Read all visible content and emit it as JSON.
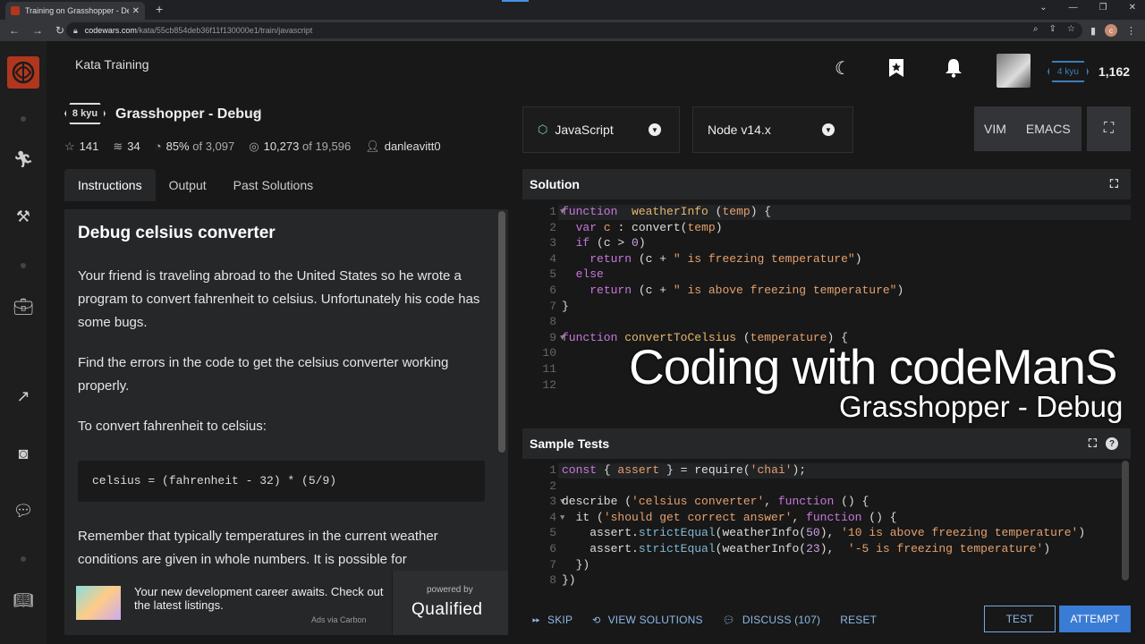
{
  "browser": {
    "tab_title": "Training on Grasshopper - Debu",
    "tab_close": "✕",
    "new_tab": "+",
    "url_host": "codewars.com",
    "url_path": "/kata/55cb854deb36f11f130000e1/train/javascript",
    "window_controls": [
      "⌄",
      "—",
      "❐",
      "✕"
    ]
  },
  "header": {
    "section_title": "Kata Training",
    "rank_badge": "4 kyu",
    "honor": "1,162"
  },
  "kata": {
    "rank": "8 kyu",
    "name": "Grasshopper - Debug",
    "stats": {
      "stars": "141",
      "collections": "34",
      "satisfaction": "85%",
      "satisfaction_of": "of 3,097",
      "completed": "10,273",
      "completed_of": "of 19,596",
      "author": "danleavitt0"
    },
    "tabs": [
      "Instructions",
      "Output",
      "Past Solutions"
    ]
  },
  "description": {
    "heading": "Debug celsius converter",
    "paragraphs": [
      "Your friend is traveling abroad to the United States so he wrote a program to convert fahrenheit to celsius. Unfortunately his code has some bugs.",
      "Find the errors in the code to get the celsius converter working properly.",
      "To convert fahrenheit to celsius:"
    ],
    "code": "celsius = (fahrenheit - 32) * (5/9)",
    "paragraph_after": "Remember that typically temperatures in the current weather conditions are given in whole numbers. It is possible for"
  },
  "ad": {
    "text": "Your new development career awaits. Check out the latest listings.",
    "carbon": "Ads via Carbon",
    "powered_by": "powered by",
    "brand": "Qualified"
  },
  "toolbar": {
    "language": "JavaScript",
    "runtime": "Node v14.x",
    "modes": [
      "VIM",
      "EMACS"
    ]
  },
  "solution": {
    "title": "Solution",
    "line_numbers": [
      "1",
      "2",
      "3",
      "4",
      "5",
      "6",
      "7",
      "8",
      "9",
      "10",
      "11",
      "12"
    ]
  },
  "sample_tests": {
    "title": "Sample Tests",
    "line_numbers": [
      "1",
      "2",
      "3",
      "4",
      "5",
      "6",
      "7",
      "8"
    ]
  },
  "overlay": {
    "title": "Coding with codeManS",
    "subtitle": "Grasshopper - Debug"
  },
  "actions": {
    "skip": "SKIP",
    "view_solutions": "VIEW SOLUTIONS",
    "discuss": "DISCUSS (107)",
    "reset": "RESET",
    "test": "TEST",
    "attempt": "ATTEMPT"
  }
}
